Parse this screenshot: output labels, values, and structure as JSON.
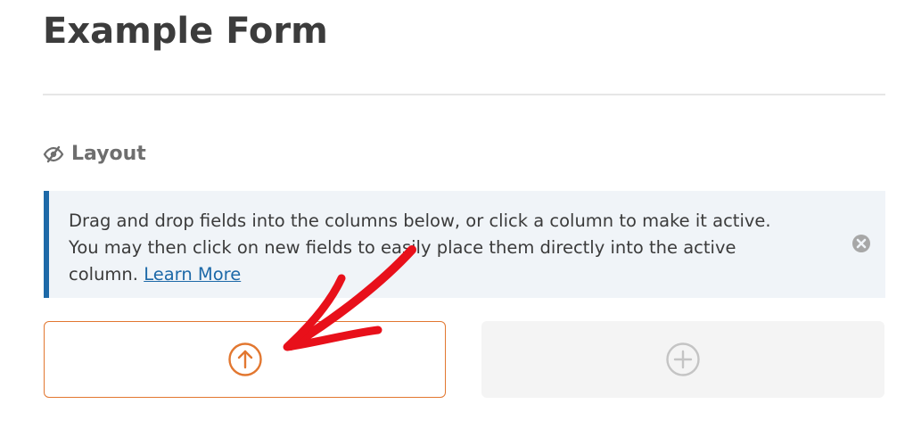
{
  "form": {
    "title": "Example Form"
  },
  "layout_section": {
    "icon": "eye-slash-icon",
    "label": "Layout"
  },
  "notice": {
    "line1": "Drag and drop fields into the columns below, or click a column to make it active.",
    "line2": "You may then click on new fields to easily place them directly into the active",
    "line3_prefix": "column. ",
    "learn_more": "Learn More",
    "dismiss_icon": "close-circle-icon",
    "accent_color": "#1d69a8",
    "background_color": "#f0f4f8"
  },
  "columns": [
    {
      "state": "active",
      "icon": "arrow-up-circle-icon",
      "color": "#e27730"
    },
    {
      "state": "inactive",
      "icon": "plus-circle-icon",
      "color": "#c4c4c4"
    }
  ],
  "annotation": {
    "icon": "red-arrow-icon",
    "color": "#e8101a"
  }
}
